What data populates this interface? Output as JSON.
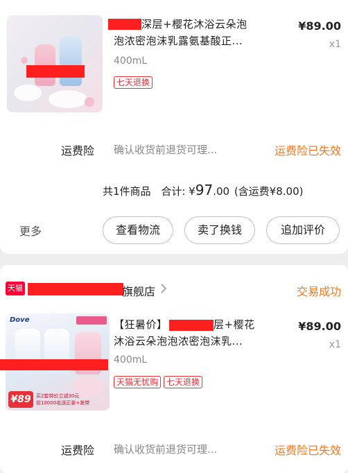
{
  "order1": {
    "product": {
      "title_line1": "深层+樱花沐浴云朵泡",
      "title_line2": "泡浓密泡沫乳露氨基酸正...",
      "spec": "400mL",
      "price": "¥89.00",
      "qty": "x1",
      "tags": [
        "七天退换"
      ]
    },
    "insurance": {
      "label": "运费险",
      "desc": "确认收货前退货可理...",
      "status": "运费险已失效"
    },
    "summary": {
      "count": "共1件商品",
      "total_label": "合计:",
      "currency": "¥",
      "total_int": "97",
      "total_dec": ".00",
      "shipping": "(含运费¥8.00)"
    },
    "actions": {
      "more": "更多",
      "logistics": "查看物流",
      "resell": "卖了换钱",
      "review": "追加评价"
    }
  },
  "order2": {
    "store": {
      "badge": "天猫",
      "name_suffix": "旗舰店",
      "status": "交易成功"
    },
    "product": {
      "title_line1": "【狂暑价】",
      "title_line1_tail": "层+樱花",
      "title_line2": "沐浴云朵泡泡浓密泡沫乳...",
      "spec": "400mL",
      "price": "¥89.00",
      "qty": "x1",
      "tags": [
        "天猫无忧购",
        "七天退换"
      ],
      "thumb_brand": "Dove",
      "thumb_price": "¥89",
      "thumb_promo1": "买2套特价立减30元",
      "thumb_promo2": "前10000名送正装+发带"
    },
    "insurance": {
      "label": "运费险",
      "desc": "确认收货前退货可理...",
      "status": "运费险已失效"
    }
  },
  "colors": {
    "accent_red": "#e8303a",
    "accent_orange": "#f07a1f",
    "tmall_red": "#ff0036",
    "redaction": "#ff1f1f"
  }
}
